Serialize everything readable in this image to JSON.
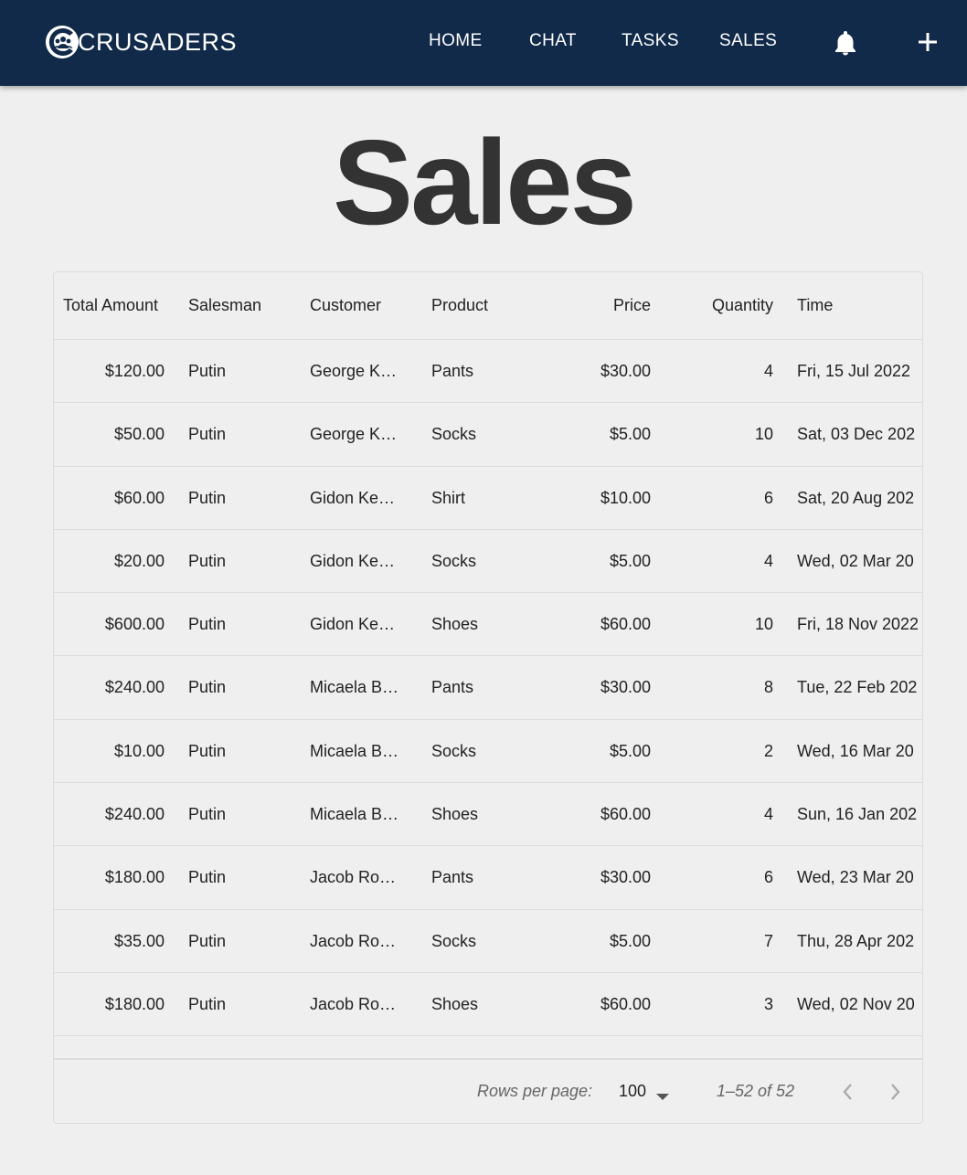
{
  "appbar": {
    "brand": "CRUSADERS",
    "nav": [
      {
        "label": "HOME"
      },
      {
        "label": "CHAT"
      },
      {
        "label": "TASKS"
      },
      {
        "label": "SALES"
      }
    ],
    "background": "#112a4a"
  },
  "page": {
    "title": "Sales"
  },
  "table": {
    "columns": [
      "Total Amount",
      "Salesman",
      "Customer",
      "Product",
      "Price",
      "Quantity",
      "Time"
    ],
    "rows": [
      [
        "$120.00",
        "Putin",
        "George K…",
        "Pants",
        "$30.00",
        "4",
        "Fri, 15 Jul 2022"
      ],
      [
        "$50.00",
        "Putin",
        "George K…",
        "Socks",
        "$5.00",
        "10",
        "Sat, 03 Dec 202"
      ],
      [
        "$60.00",
        "Putin",
        "Gidon Ke…",
        "Shirt",
        "$10.00",
        "6",
        "Sat, 20 Aug 202"
      ],
      [
        "$20.00",
        "Putin",
        "Gidon Ke…",
        "Socks",
        "$5.00",
        "4",
        "Wed, 02 Mar 20"
      ],
      [
        "$600.00",
        "Putin",
        "Gidon Ke…",
        "Shoes",
        "$60.00",
        "10",
        "Fri, 18 Nov 2022"
      ],
      [
        "$240.00",
        "Putin",
        "Micaela B…",
        "Pants",
        "$30.00",
        "8",
        "Tue, 22 Feb 202"
      ],
      [
        "$10.00",
        "Putin",
        "Micaela B…",
        "Socks",
        "$5.00",
        "2",
        "Wed, 16 Mar 20"
      ],
      [
        "$240.00",
        "Putin",
        "Micaela B…",
        "Shoes",
        "$60.00",
        "4",
        "Sun, 16 Jan 202"
      ],
      [
        "$180.00",
        "Putin",
        "Jacob Ro…",
        "Pants",
        "$30.00",
        "6",
        "Wed, 23 Mar 20"
      ],
      [
        "$35.00",
        "Putin",
        "Jacob Ro…",
        "Socks",
        "$5.00",
        "7",
        "Thu, 28 Apr 202"
      ],
      [
        "$180.00",
        "Putin",
        "Jacob Ro…",
        "Shoes",
        "$60.00",
        "3",
        "Wed, 02 Nov 20"
      ]
    ]
  },
  "pagination": {
    "rows_per_page_label": "Rows per page:",
    "rows_per_page_value": "100",
    "range": "1–52 of 52"
  }
}
